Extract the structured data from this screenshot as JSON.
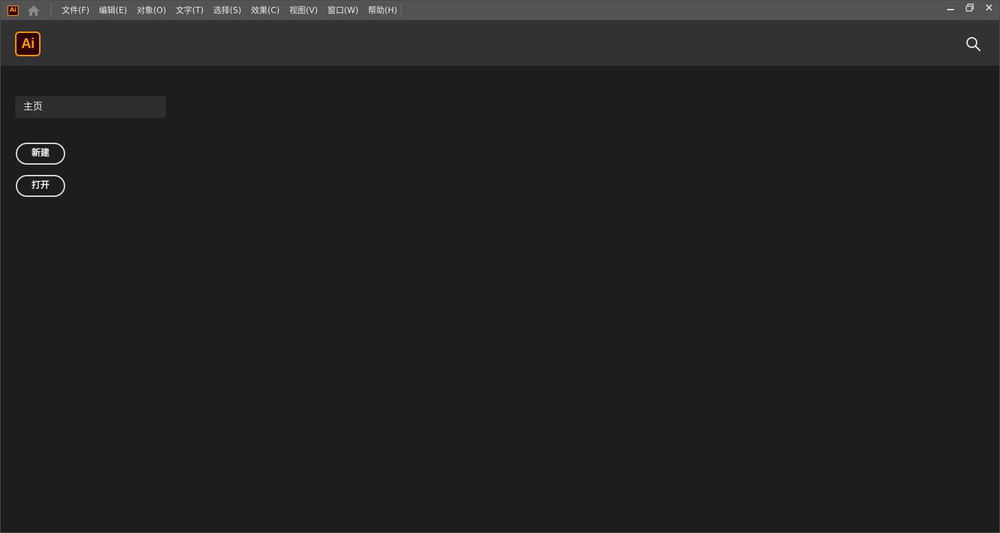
{
  "titlebar": {
    "app_badge": "Ai",
    "menu": [
      {
        "label": "文件(F)"
      },
      {
        "label": "编辑(E)"
      },
      {
        "label": "对象(O)"
      },
      {
        "label": "文字(T)"
      },
      {
        "label": "选择(S)"
      },
      {
        "label": "效果(C)"
      },
      {
        "label": "视图(V)"
      },
      {
        "label": "窗口(W)"
      },
      {
        "label": "帮助(H)"
      }
    ],
    "window_controls": [
      "minimize-icon",
      "restore-icon",
      "close-icon"
    ]
  },
  "header": {
    "logo_text": "Ai",
    "search_icon": "search-icon"
  },
  "sidebar": {
    "home_tab": "主页",
    "new_button": "新建",
    "open_button": "打开"
  },
  "colors": {
    "brand_bg": "#330000",
    "brand_accent": "#ff9a00",
    "background": "#1d1d1d",
    "header": "#323232",
    "titlebar": "#535353"
  }
}
